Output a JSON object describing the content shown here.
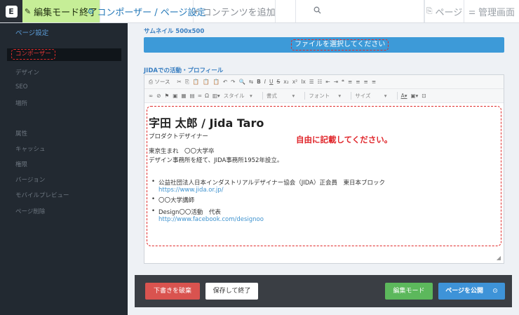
{
  "topbar": {
    "logo_glyph": "E",
    "edit_mode_end": "編集モード終了",
    "edit_icon": "pencil-icon",
    "composer_page_settings": "コンポーザー / ページ設定",
    "composer_icon": "gear-icon",
    "add_contents": "コンテンツを追加",
    "add_icon": "plus-icon",
    "search_icon": "search-icon",
    "page": "ページ",
    "admin": "管理画面"
  },
  "sidebar": {
    "title": "ページ設定",
    "items": [
      {
        "label": "コンポーザー",
        "active": true
      },
      {
        "label": "デザイン"
      },
      {
        "label": "SEO"
      },
      {
        "label": "場所"
      },
      {
        "label": "属性"
      },
      {
        "label": "キャッシュ"
      },
      {
        "label": "権限"
      },
      {
        "label": "バージョン"
      },
      {
        "label": "モバイルプレビュー"
      },
      {
        "label": "ページ削除"
      }
    ]
  },
  "main": {
    "thumbnail_label": "サムネイル 500x500",
    "select_file": "ファイルを選択してください",
    "profile_label": "JIDAでの活動・プロフィール",
    "toolbar": {
      "source": "ソース",
      "style": "スタイル",
      "format": "書式",
      "font": "フォント",
      "size": "サイズ"
    },
    "content": {
      "name": "字田 太郎 / Jida Taro",
      "role": "プロダクトデザイナー",
      "hint": "自由に記載してください。",
      "bio1": "東京生まれ　〇〇大学卒",
      "bio2": "デザイン事務所を経て、JIDA事務所1952年設立。",
      "list": [
        {
          "text": "公益社団法人日本インダストリアルデザイナー協会（JIDA）正会員　東日本ブロック",
          "link": "https://www.jida.or.jp/"
        },
        {
          "text": "〇〇大学講師"
        },
        {
          "text": "Design〇〇活動　代表",
          "link": "http://www.facebook.com/designoo"
        }
      ]
    }
  },
  "footer": {
    "discard_draft": "下書きを破棄",
    "save_and_exit": "保存して終了",
    "edit_mode": "編集モード",
    "publish_page": "ページを公開"
  },
  "colors": {
    "edit_mode_bg": "#c6ee97",
    "sidebar_bg": "#222931",
    "accent_blue": "#3d9ad8",
    "annotation_red": "#e02b2b",
    "discard_red": "#d9534f",
    "mode_green": "#5cb85c"
  }
}
